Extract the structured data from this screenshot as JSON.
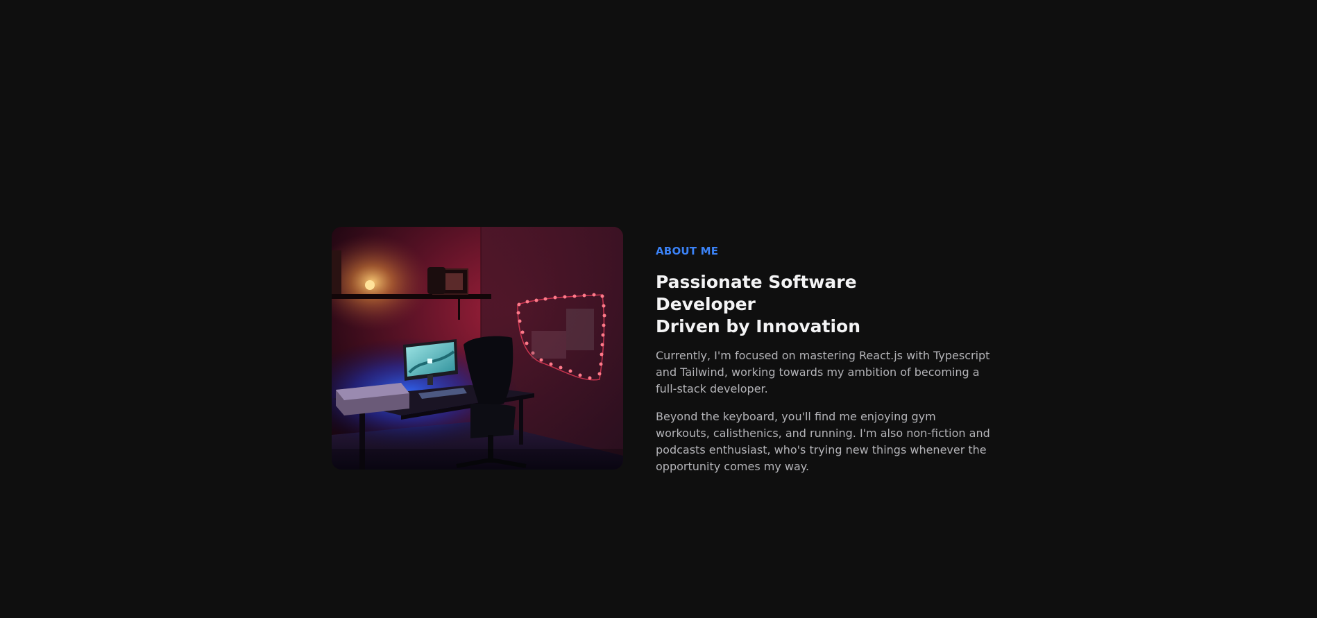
{
  "about": {
    "eyebrow": "ABOUT ME",
    "heading_line1": "Passionate Software Developer",
    "heading_line2": "Driven by Innovation",
    "paragraph1": "Currently, I'm focused on mastering React.js with Typescript and Tailwind, working towards my ambition of becoming a full-stack developer.",
    "paragraph2": "Beyond the keyboard, you'll find me enjoying gym workouts, calisthenics, and running. I'm also non-fiction and podcasts enthusiast, who's trying new things whenever the opportunity comes my way."
  },
  "colors": {
    "background": "#0f0f0f",
    "accent": "#3b82f6",
    "heading": "#f4f4f5",
    "body_text": "#b4b4b8"
  }
}
